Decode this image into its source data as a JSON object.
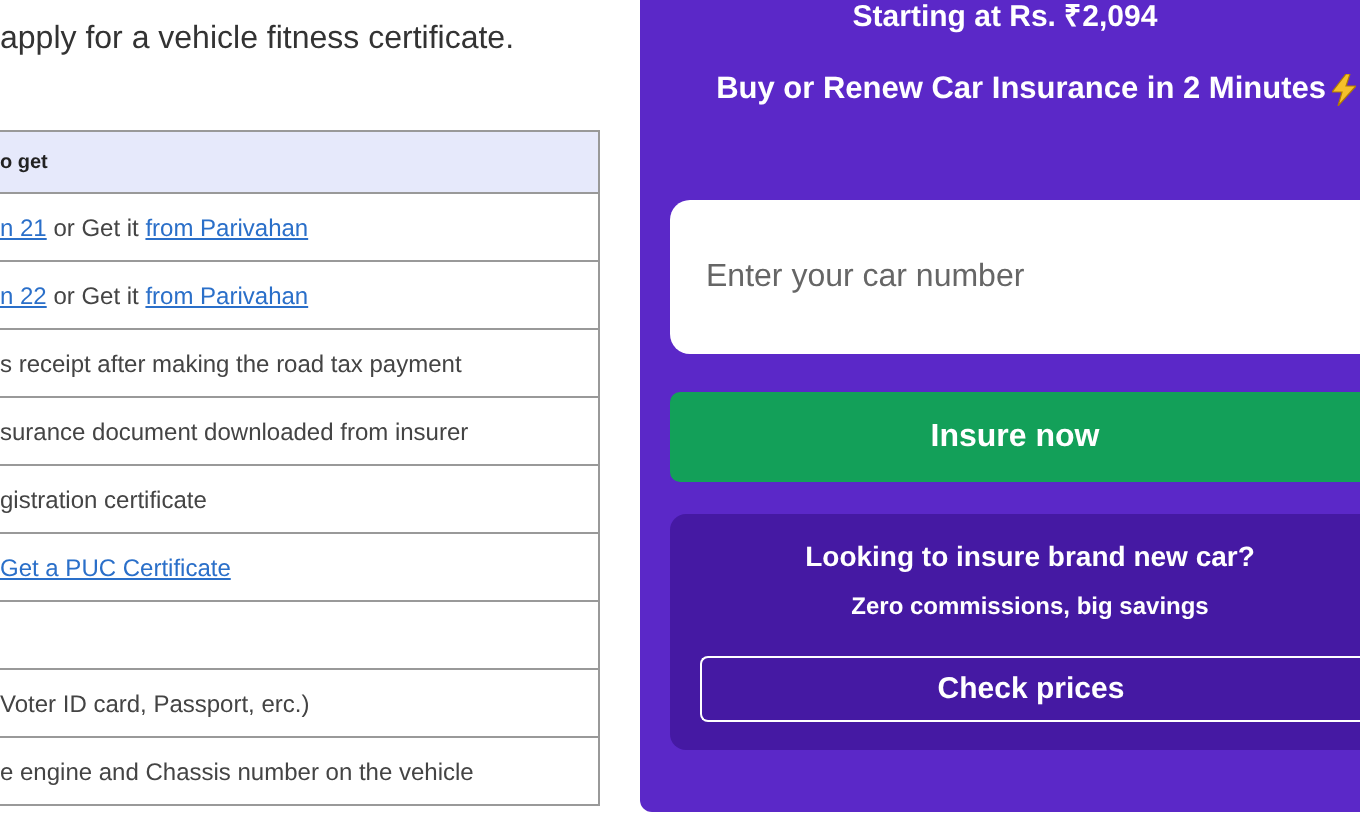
{
  "intro": "apply for a vehicle fitness certificate.",
  "table": {
    "header": "o get",
    "rows": [
      [
        {
          "text": "n 21",
          "link": true
        },
        {
          "text": " or Get it ",
          "link": false
        },
        {
          "text": "from Parivahan",
          "link": true
        }
      ],
      [
        {
          "text": "n 22",
          "link": true
        },
        {
          "text": " or Get it ",
          "link": false
        },
        {
          "text": "from Parivahan",
          "link": true
        }
      ],
      [
        {
          "text": "s receipt after making the road tax payment",
          "link": false
        }
      ],
      [
        {
          "text": "surance document downloaded from insurer",
          "link": false
        }
      ],
      [
        {
          "text": "gistration certificate",
          "link": false
        }
      ],
      [
        {
          "text": "Get a PUC Certificate",
          "link": true
        }
      ],
      [],
      [
        {
          "text": "Voter ID card, Passport, erc.)",
          "link": false
        }
      ],
      [
        {
          "text": "e engine and Chassis number on the vehicle",
          "link": false
        }
      ]
    ]
  },
  "promo": {
    "headline": "Starting at Rs. ₹2,094",
    "tagline": "Buy or Renew Car Insurance in 2 Minutes",
    "car_number": {
      "placeholder": "Enter your car number"
    },
    "insure_button": "Insure now",
    "new_car": {
      "title": "Looking to insure brand new car?",
      "subtitle": "Zero commissions, big savings",
      "button": "Check prices"
    }
  }
}
